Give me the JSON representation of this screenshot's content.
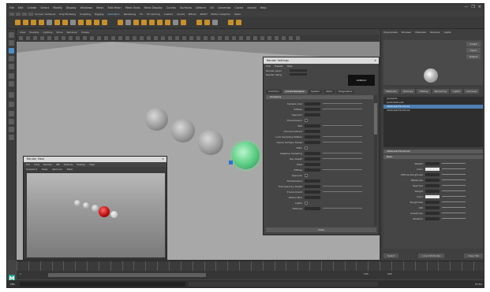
{
  "app": {
    "title": "Autodesk Maya",
    "logo_letter": "M"
  },
  "menubar": {
    "items": [
      "File",
      "Edit",
      "Create",
      "Select",
      "Modify",
      "Display",
      "Windows",
      "Mesh",
      "Edit Mesh",
      "Mesh Tools",
      "Mesh Display",
      "Curves",
      "Surfaces",
      "Deform",
      "UV",
      "Generate",
      "Cache",
      "Arnold",
      "Help"
    ],
    "window_controls": [
      "—",
      "❐",
      "✕"
    ]
  },
  "shelf_tabs": [
    "Curves / Surfaces",
    "Poly Modeling",
    "Sculpting",
    "Rigging",
    "Animation",
    "Rendering",
    "FX",
    "FX Caching",
    "Custom",
    "Arnold",
    "Bifrost",
    "MASH",
    "Motion Graphics",
    "XGen"
  ],
  "viewport": {
    "menu": [
      "View",
      "Shading",
      "Lighting",
      "Show",
      "Renderer",
      "Panels"
    ]
  },
  "render_view": {
    "title": "Render View",
    "close": "✕",
    "menu": [
      "File",
      "View",
      "Render",
      "IPR",
      "Options",
      "Display",
      "Help"
    ],
    "toolbar": [
      "Snapshot",
      "Keep",
      "Remove",
      "Ratio"
    ]
  },
  "attr_editor": {
    "title": "Render Settings",
    "close": "✕",
    "menu": [
      "Edit",
      "Presets",
      "Help"
    ],
    "rows": [
      {
        "label": "Render Layer",
        "value": "masterLayer"
      },
      {
        "label": "Render Using",
        "value": "Arnold Renderer"
      }
    ],
    "thumb": "ARNOLD",
    "tabs": [
      "Common",
      "Arnold Renderer",
      "System",
      "AOVs",
      "Diagnostics"
    ],
    "section": "Sampling",
    "fields": [
      "Camera (AA)",
      "Diffuse",
      "Specular",
      "Transmission",
      "SSS",
      "Volume Indirect",
      "Lock Sampling Pattern",
      "Clamp Sample Values",
      "Filter",
      "Adaptive Sampling",
      "Ray Depth",
      "Total",
      "Diffuse",
      "Specular",
      "Transmission",
      "Transparency Depth",
      "Environment",
      "Motion Blur",
      "Lights",
      "Textures"
    ],
    "button": "Close"
  },
  "sidebar": {
    "tabs": [
      "Hypershade",
      "Browser",
      "Materials",
      "Textures",
      "Lights"
    ],
    "swatch_buttons": [
      "Graph",
      "Input",
      "Output"
    ],
    "list_tabs": [
      "Materials",
      "Textures",
      "Utilities",
      "Rendering",
      "Lights",
      "Cameras"
    ],
    "list": [
      "lambert1",
      "particleCloud1",
      "aiStandardSurface1",
      "aiStandardSurface2"
    ],
    "selected_index": 2,
    "props_title": "aiStandardSurface2",
    "props_section": "Base",
    "props": [
      "Weight",
      "Color",
      "Diffuse Roughness",
      "Metalness",
      "Specular",
      "Weight",
      "Color",
      "Roughness",
      "IOR",
      "Anisotropy",
      "Rotation"
    ],
    "buttons": [
      "Select",
      "Load Attributes",
      "Copy Tab"
    ]
  },
  "range": {
    "start": "1",
    "end": "120",
    "max": "200"
  },
  "cmdline": {
    "label": "MEL",
    "right": "24 fps"
  }
}
